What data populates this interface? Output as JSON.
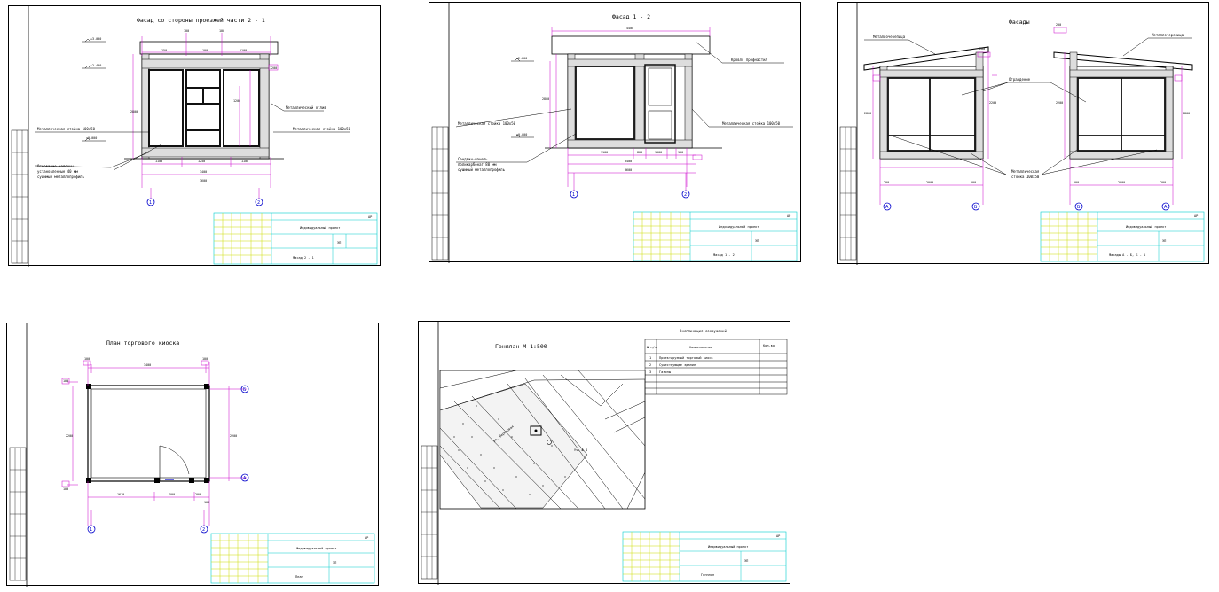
{
  "sheets": [
    {
      "title": "Фасад со стороны проезжей части 2 - 1",
      "levels": [
        "+3.000",
        "+2.400",
        "±0.000"
      ],
      "dims_top": [
        "100",
        "100",
        "150",
        "100",
        "1100",
        "1200"
      ],
      "dims_bottom": [
        "1100",
        "1250",
        "1100",
        "3400",
        "3600"
      ],
      "dims_right": [
        "1200",
        "600",
        "600",
        "800",
        "200",
        "2800"
      ],
      "notes": [
        "Металлический отлив",
        "Металлическая стойка 100x50",
        "Металлическая стойка 100x50",
        "Основание колонны",
        "установленные 40 мм",
        "сушимый металлопрофиль"
      ],
      "axes": [
        "1",
        "2"
      ],
      "tb_code": "АР",
      "tb_org": "Индивидуальный проект",
      "tb_sheet_name": "Фасад 2 - 1",
      "tb_stage": "ЭП"
    },
    {
      "title": "Фасад 1 - 2",
      "levels": [
        "+2.800",
        "±0.000"
      ],
      "dims_top": [
        "4400"
      ],
      "dims_bottom": [
        "1100",
        "800",
        "1000",
        "100",
        "3400",
        "3600"
      ],
      "dims_right": [
        "2800"
      ],
      "notes": [
        "Кровля профнастил",
        "Металлическая стойка 100x50",
        "Металлическая стойка 100x50",
        "Сэндвич-панель",
        "поликарбонат 80 мм",
        "сушимый металлопрофиль"
      ],
      "axes": [
        "1",
        "2"
      ],
      "tb_code": "АР",
      "tb_org": "Индивидуальный проект",
      "tb_sheet_name": "Фасад 1 - 2",
      "tb_stage": "ЭП"
    },
    {
      "title": "Фасады",
      "dims_top": [
        "200",
        "200"
      ],
      "dims_bottom": [
        "200",
        "2000",
        "200",
        "200",
        "2000",
        "200"
      ],
      "dims_side": [
        "2800",
        "2200",
        "2200",
        "2800"
      ],
      "notes": [
        "Металлочерепица",
        "Металлочерепица",
        "Ограждение",
        "Металлическая",
        "стойка 100x50"
      ],
      "axes": [
        "A",
        "Б",
        "Б",
        "А"
      ],
      "tb_code": "АР",
      "tb_org": "Индивидуальный проект",
      "tb_sheet_name": "Фасады А - Б, Б - А",
      "tb_stage": "ЭП"
    },
    {
      "title": "План торгового киоска",
      "dims_top": [
        "100",
        "3400",
        "100"
      ],
      "dims_bottom": [
        "100",
        "1610",
        "500",
        "200",
        "100"
      ],
      "dims_side": [
        "100",
        "2200",
        "100",
        "2200"
      ],
      "axes": [
        "1",
        "2",
        "А",
        "Б"
      ],
      "tb_code": "АР",
      "tb_org": "Индивидуальный проект",
      "tb_sheet_name": "План",
      "tb_stage": "ЭП"
    },
    {
      "title": "Генплан М 1:500",
      "table_title": "Экспликация сооружений",
      "table_headers": [
        "№ п/п",
        "Наименование",
        "Кол-во"
      ],
      "table_rows": [
        [
          "1",
          "Проектируемый торговый киоск",
          ""
        ],
        [
          "2",
          "Существующее здание",
          ""
        ],
        [
          "3",
          "Газоны",
          ""
        ]
      ],
      "map_labels": [
        "ул. Березовая",
        "Уч. № 4"
      ],
      "tb_code": "АР",
      "tb_org": "Индивидуальный проект",
      "tb_sheet_name": "Генплан",
      "tb_stage": "ЭП"
    }
  ],
  "colors": {
    "dimension": "#cc00cc",
    "stamp_grid": "#ccdd00",
    "stamp_border": "#00cccc",
    "axis_marker": "#0000cc",
    "drawing": "#000000"
  }
}
